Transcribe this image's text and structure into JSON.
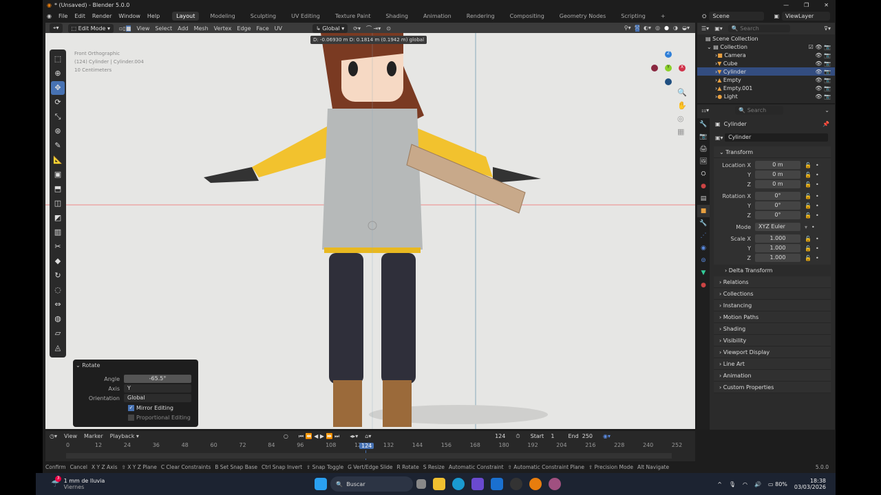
{
  "window": {
    "title": "* (Unsaved) - Blender 5.0.0",
    "controls": [
      "—",
      "❐",
      "✕"
    ]
  },
  "menu": [
    "File",
    "Edit",
    "Render",
    "Window",
    "Help"
  ],
  "workspaces": [
    "Layout",
    "Modeling",
    "Sculpting",
    "UV Editing",
    "Texture Paint",
    "Shading",
    "Animation",
    "Rendering",
    "Compositing",
    "Geometry Nodes",
    "Scripting",
    "+"
  ],
  "scene": "Scene",
  "view_layer": "ViewLayer",
  "viewport_header": {
    "mode": "Edit Mode",
    "menus": [
      "View",
      "Select",
      "Add",
      "Mesh",
      "Vertex",
      "Edge",
      "Face",
      "UV"
    ],
    "orientation": "Global"
  },
  "viewport": {
    "info": [
      "Front Orthographic",
      "(124) Cylinder | Cylinder.004",
      "10 Centimeters"
    ],
    "tooltip": "D: -0.06930 m  D: 0.1814 m (0.1942 m) global",
    "gizmo": {
      "x": "X",
      "y": "Y",
      "z": "Z"
    }
  },
  "rotate_panel": {
    "title": "Rotate",
    "angle_label": "Angle",
    "angle": "-65.5°",
    "axis_label": "Axis",
    "axis": "Y",
    "orientation_label": "Orientation",
    "orientation": "Global",
    "mirror": "Mirror Editing",
    "mirror_checked": true,
    "proportional": "Proportional Editing",
    "proportional_checked": false
  },
  "outliner": {
    "search": "Search",
    "root": "Scene Collection",
    "collection": "Collection",
    "items": [
      "Camera",
      "Cube",
      "Cylinder",
      "Empty",
      "Empty.001",
      "Light"
    ]
  },
  "properties": {
    "search": "Search",
    "object": "Cylinder",
    "datablock": "Cylinder",
    "transform": "Transform",
    "fields": [
      {
        "label": "Location X",
        "value": "0 m"
      },
      {
        "label": "Y",
        "value": "0 m"
      },
      {
        "label": "Z",
        "value": "0 m"
      },
      {
        "label": "Rotation X",
        "value": "0°"
      },
      {
        "label": "Y",
        "value": "0°"
      },
      {
        "label": "Z",
        "value": "0°"
      },
      {
        "label": "Mode",
        "value": "XYZ Euler"
      },
      {
        "label": "Scale X",
        "value": "1.000"
      },
      {
        "label": "Y",
        "value": "1.000"
      },
      {
        "label": "Z",
        "value": "1.000"
      }
    ],
    "delta": "Delta Transform",
    "sections": [
      "Relations",
      "Collections",
      "Instancing",
      "Motion Paths",
      "Shading",
      "Visibility",
      "Viewport Display",
      "Line Art",
      "Animation",
      "Custom Properties"
    ]
  },
  "timeline": {
    "menus": [
      "View",
      "Marker",
      "Playback"
    ],
    "current": "124",
    "start_label": "Start",
    "start": "1",
    "end_label": "End",
    "end": "250",
    "ticks": [
      "0",
      "12",
      "24",
      "36",
      "48",
      "60",
      "72",
      "84",
      "96",
      "108",
      "12",
      "132",
      "144",
      "156",
      "168",
      "180",
      "192",
      "204",
      "216",
      "228",
      "240",
      "252"
    ]
  },
  "statusbar": {
    "items": [
      "Confirm",
      "Cancel",
      "X Y Z Axis",
      "⇧ X Y Z Plane",
      "C Clear Constraints",
      "B Set Snap Base",
      "Ctrl Snap Invert",
      "⇧ Snap Toggle",
      "G Vert/Edge Slide",
      "R Rotate",
      "S Resize",
      "Automatic Constraint",
      "⇧ Automatic Constraint Plane",
      "⇧ Precision Mode",
      "Alt Navigate"
    ],
    "version": "5.0.0"
  },
  "taskbar": {
    "weather": "1 mm de lluvia",
    "weather_day": "Viernes",
    "badge": "3",
    "search": "Buscar",
    "battery": "80%",
    "time": "18:38",
    "date": "03/03/2026"
  }
}
